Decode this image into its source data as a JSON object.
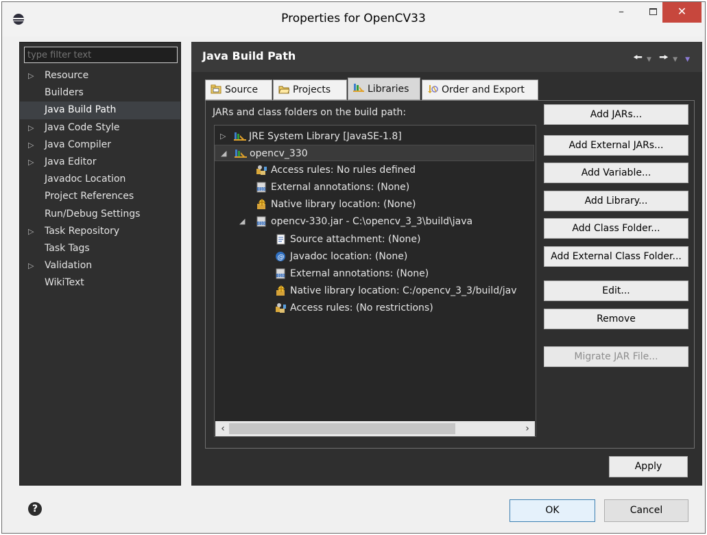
{
  "window": {
    "title": "Properties for OpenCV33",
    "minimize_label": "–",
    "close_label": "✕"
  },
  "sidebar": {
    "filter_placeholder": "type filter text",
    "items": [
      {
        "label": "Resource",
        "expandable": true
      },
      {
        "label": "Builders",
        "expandable": false
      },
      {
        "label": "Java Build Path",
        "expandable": false,
        "selected": true
      },
      {
        "label": "Java Code Style",
        "expandable": true
      },
      {
        "label": "Java Compiler",
        "expandable": true
      },
      {
        "label": "Java Editor",
        "expandable": true
      },
      {
        "label": "Javadoc Location",
        "expandable": false
      },
      {
        "label": "Project References",
        "expandable": false
      },
      {
        "label": "Run/Debug Settings",
        "expandable": false
      },
      {
        "label": "Task Repository",
        "expandable": true
      },
      {
        "label": "Task Tags",
        "expandable": false
      },
      {
        "label": "Validation",
        "expandable": true
      },
      {
        "label": "WikiText",
        "expandable": false
      }
    ]
  },
  "header": {
    "page_title": "Java Build Path",
    "back_icon": "arrow-left-icon",
    "forward_icon": "arrow-right-icon"
  },
  "tabs": [
    {
      "label": "Source",
      "icon": "source-folder-icon"
    },
    {
      "label": "Projects",
      "icon": "project-folder-icon"
    },
    {
      "label": "Libraries",
      "icon": "library-icon",
      "active": true
    },
    {
      "label": "Order and Export",
      "icon": "order-icon"
    }
  ],
  "libraries": {
    "section_label": "JARs and class folders on the build path:",
    "tree": [
      {
        "label": "JRE System Library [JavaSE-1.8]",
        "icon": "library-icon",
        "twisty": "▷"
      },
      {
        "label": "opencv_330",
        "icon": "library-icon",
        "twisty": "◢"
      },
      {
        "label": "Access rules: No rules defined",
        "icon": "access-rules-icon"
      },
      {
        "label": "External annotations: (None)",
        "icon": "annotations-icon"
      },
      {
        "label": "Native library location: (None)",
        "icon": "native-library-icon"
      },
      {
        "label": "opencv-330.jar - C:\\opencv_3_3\\build\\java",
        "icon": "jar-icon",
        "twisty": "◢"
      },
      {
        "label": "Source attachment: (None)",
        "icon": "source-attachment-icon"
      },
      {
        "label": "Javadoc location: (None)",
        "icon": "javadoc-icon"
      },
      {
        "label": "External annotations: (None)",
        "icon": "annotations-icon"
      },
      {
        "label": "Native library location: C:/opencv_3_3/build/jav",
        "icon": "native-library-icon"
      },
      {
        "label": "Access rules: (No restrictions)",
        "icon": "access-rules-icon"
      }
    ],
    "buttons": [
      {
        "label": "Add JARs...",
        "enabled": true
      },
      {
        "label": "Add External JARs...",
        "enabled": true
      },
      {
        "label": "Add Variable...",
        "enabled": true
      },
      {
        "label": "Add Library...",
        "enabled": true
      },
      {
        "label": "Add Class Folder...",
        "enabled": true
      },
      {
        "label": "Add External Class Folder...",
        "enabled": true
      },
      {
        "label": "Edit...",
        "enabled": true
      },
      {
        "label": "Remove",
        "enabled": true
      },
      {
        "label": "Migrate JAR File...",
        "enabled": false
      }
    ]
  },
  "footer": {
    "apply_label": "Apply",
    "ok_label": "OK",
    "cancel_label": "Cancel",
    "help_label": "?"
  }
}
